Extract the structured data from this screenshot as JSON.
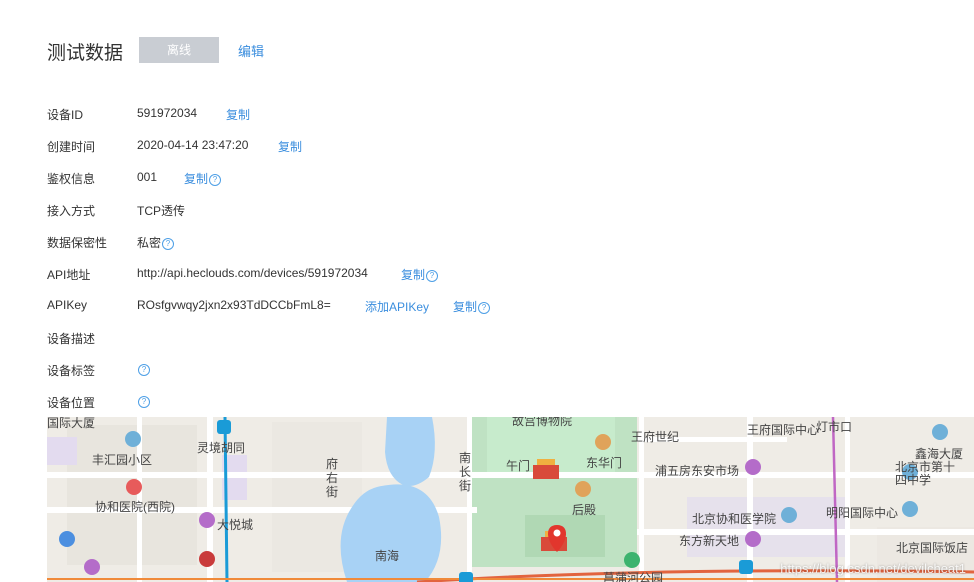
{
  "header": {
    "title": "测试数据",
    "status": "离线",
    "edit": "编辑"
  },
  "fields": {
    "device_id": {
      "label": "设备ID",
      "value": "591972034",
      "copy": "复制"
    },
    "created": {
      "label": "创建时间",
      "value": "2020-04-14 23:47:20",
      "copy": "复制"
    },
    "auth": {
      "label": "鉴权信息",
      "value": "001",
      "copy": "复制"
    },
    "access": {
      "label": "接入方式",
      "value": "TCP透传"
    },
    "privacy": {
      "label": "数据保密性",
      "value": "私密"
    },
    "api_url": {
      "label": "API地址",
      "value": "http://api.heclouds.com/devices/591972034",
      "copy": "复制"
    },
    "api_key": {
      "label": "APIKey",
      "value": "ROsfgvwqy2jxn2x93TdDCCbFmL8=",
      "add": "添加APIKey",
      "copy": "复制"
    },
    "desc": {
      "label": "设备描述"
    },
    "tags": {
      "label": "设备标签"
    },
    "location": {
      "label": "设备位置"
    }
  },
  "help_glyph": "?",
  "map": {
    "labels": {
      "guoji_dasha": "国际大厦",
      "fenghuiyuan": "丰汇园小区",
      "lingjinghutong": "灵境胡同",
      "xiehe": "协和医院(西院)",
      "dayuecheng": "大悦城",
      "fuyoujie": "府右街",
      "nanhai": "南海",
      "gugong": "故宫博物院",
      "wumen": "午门",
      "donghuamen": "东华门",
      "houdian": "后殿",
      "nanchangjie": "南长街",
      "wangfu": "王府世纪",
      "pudong": "浦五房东安市场",
      "fuguoji": "王府国际中心",
      "dengshikou": "灯市口",
      "xiehe_medical": "北京协和医学院",
      "dongfang": "东方新天地",
      "mingyang": "明阳国际中心",
      "xinhai": "鑫海大厦",
      "beijing_14": "北京市第十四中学",
      "beijing_hotel": "北京国际饭店",
      "puhe": "菖蒲河公园"
    },
    "watermark": "https://blog.csdn.net/devilcheat1"
  }
}
